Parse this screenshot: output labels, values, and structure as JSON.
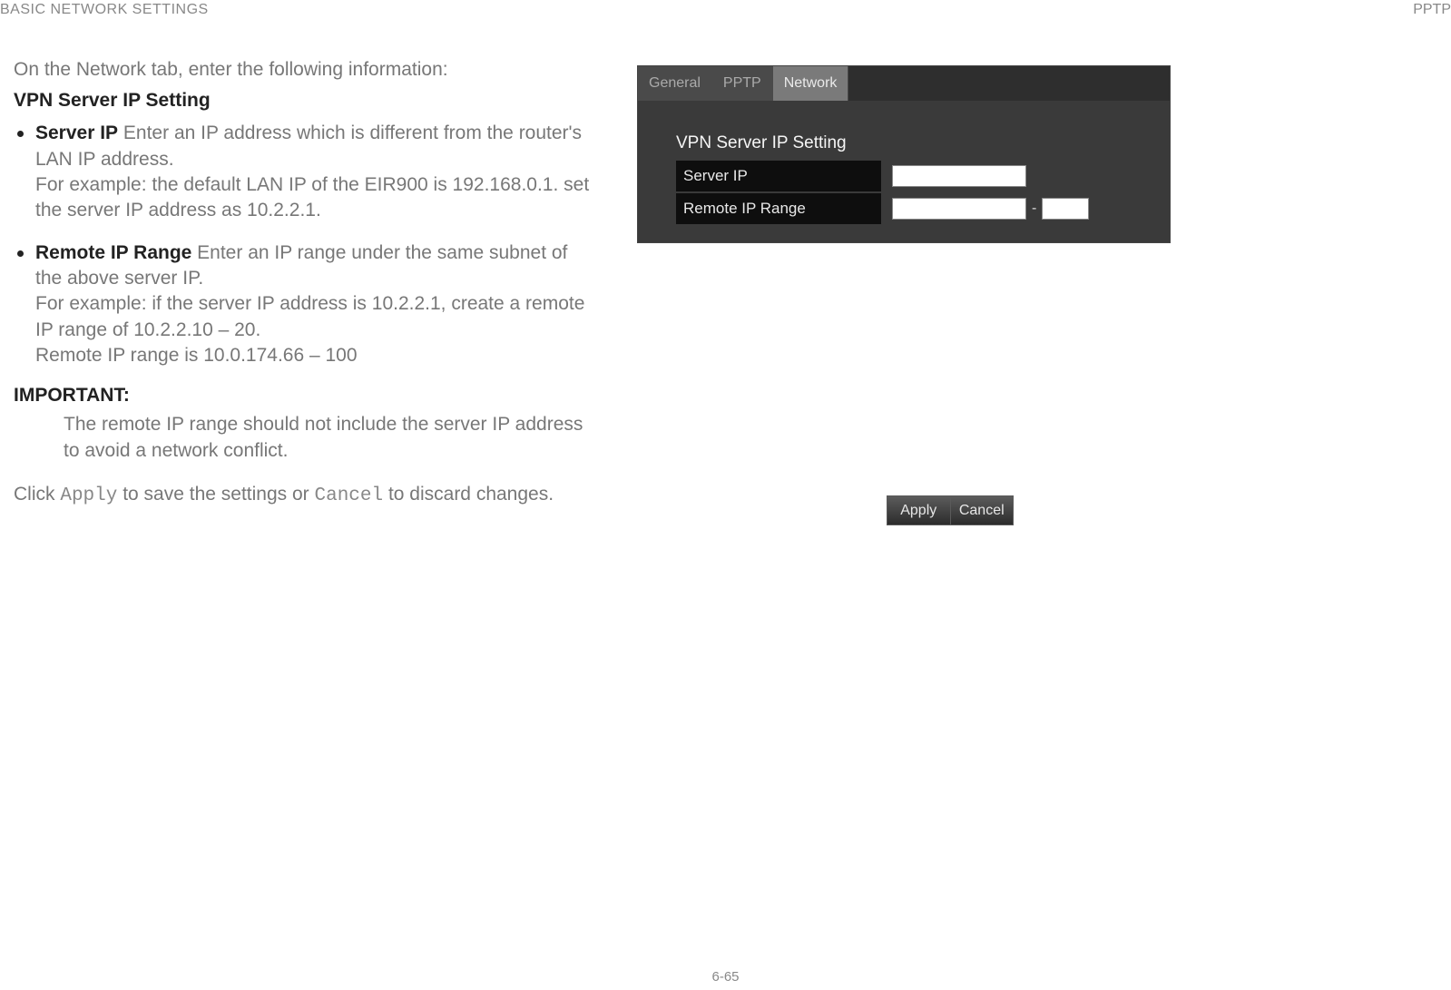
{
  "header": {
    "left": "BASIC NETWORK SETTINGS",
    "right": "PPTP"
  },
  "content": {
    "intro": "On the Network tab, enter the following information:",
    "subheading": "VPN Server IP Setting",
    "bullets": {
      "server_ip": {
        "label": "Server IP",
        "desc": "  Enter an IP address which is different from the router's LAN IP address.",
        "cont1": "For example: the default LAN IP of the EIR900 is 192.168.0.1. set the server IP address as 10.2.2.1."
      },
      "remote_ip": {
        "label": "Remote IP Range",
        "desc": "  Enter an IP range under the same subnet of the above server IP.",
        "cont1": "For example: if the server IP address is 10.2.2.1, create a remote IP range of 10.2.2.10 – 20.",
        "cont2": "Remote IP range is 10.0.174.66 – 100"
      }
    },
    "important": {
      "heading": "IMPORTANT:",
      "body": "The remote IP range should not include the server IP address to avoid a network conflict."
    },
    "closing": {
      "pre": "Click ",
      "apply": "Apply",
      "mid": " to save the settings or ",
      "cancel": "Cancel",
      "post": " to discard changes."
    }
  },
  "shot1": {
    "tabs": {
      "general": "General",
      "pptp": "PPTP",
      "network": "Network"
    },
    "panel_title": "VPN Server IP Setting",
    "row1_label": "Server IP",
    "row2_label": "Remote IP Range",
    "dash": "-"
  },
  "shot2": {
    "apply": "Apply",
    "cancel": "Cancel"
  },
  "page_number": "6-65"
}
